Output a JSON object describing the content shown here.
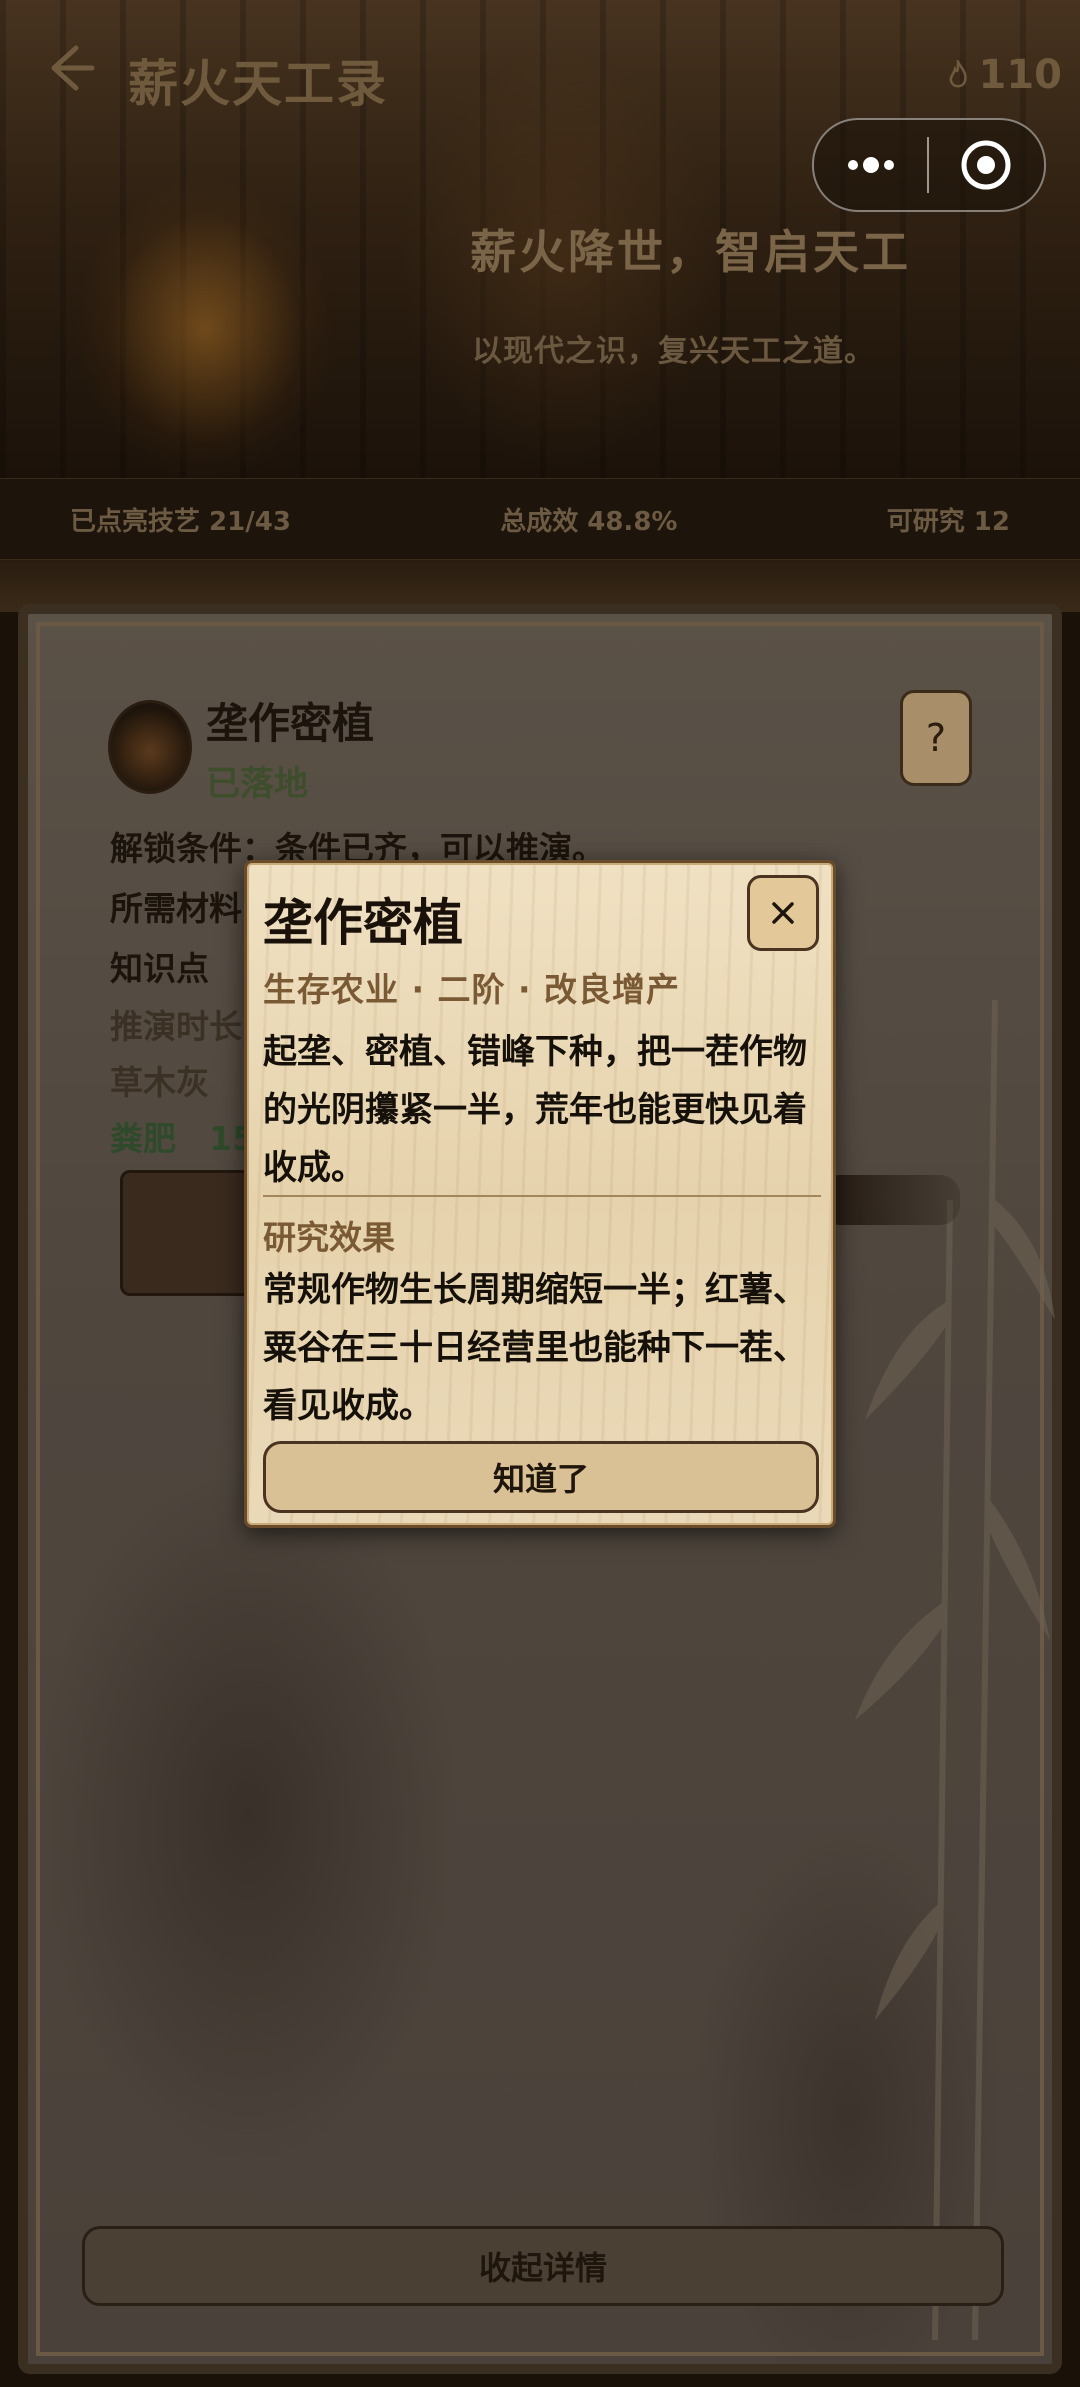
{
  "header": {
    "title": "薪火天工录",
    "coins": "110",
    "slogan": "薪火降世，智启天工",
    "subtitle": "以现代之识，复兴天工之道。"
  },
  "stats": {
    "lit_skills": "已点亮技艺 21/43",
    "total_effect": "总成效 48.8%",
    "researchable": "可研究 12"
  },
  "item": {
    "name": "垄作密植",
    "status": "已落地",
    "help": "?",
    "unlock_condition": "解锁条件：条件已齐，可以推演。",
    "materials_label": "所需材料",
    "knowledge_label": "知识点",
    "duration_label": "推演时长",
    "material_1": "草木灰",
    "material_2": "粪肥　15"
  },
  "collapse_label": "收起详情",
  "modal": {
    "title": "垄作密植",
    "tags": "生存农业 · 二阶 · 改良增产",
    "description": "起垄、密植、错峰下种，把一茬作物的光阴攥紧一半，荒年也能更快见着收成。",
    "effect_title": "研究效果",
    "effect": "常规作物生长周期缩短一半；红薯、粟谷在三十日经营里也能种下一茬、看见收成。",
    "ok_label": "知道了"
  },
  "colors": {
    "parchment": "#ead9b8",
    "accent_brown": "#7a5a34",
    "status_green": "#3e4d2c"
  }
}
